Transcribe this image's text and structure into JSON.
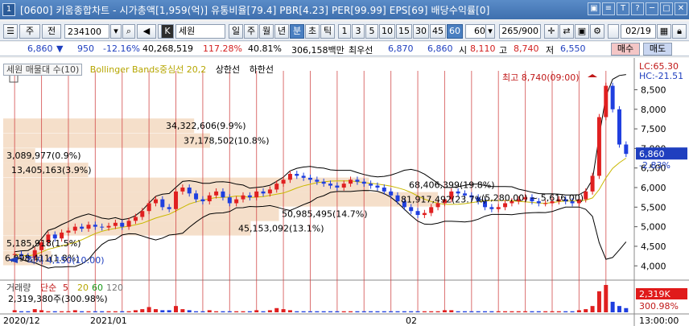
{
  "title": {
    "window_number": "1",
    "text": "[0600] 키움종합차트 - 시가총액[1,959(억)] 유통비율[79.4] PBR[4.23] PER[99.99] EPS[69] 배당수익률[0]",
    "buttons": [
      "▣",
      "≡",
      "T",
      "?",
      "─",
      "□",
      "✕"
    ]
  },
  "toolbar": {
    "stock_type": "주",
    "prev_label": "전",
    "code": "234100",
    "name": "세원",
    "periods": [
      "일",
      "주",
      "월",
      "년",
      "분",
      "초",
      "틱"
    ],
    "active_period": "분",
    "minutes": [
      "1",
      "3",
      "5",
      "10",
      "15",
      "30",
      "45",
      "60"
    ],
    "active_minute": "60",
    "interval_value": "60",
    "count": "265",
    "count_total": "/900",
    "date": "02/19"
  },
  "info": {
    "price": "6,860",
    "change": "950",
    "change_pct": "-12.16%",
    "volume": "40,268,519",
    "volume_ratio": "117.28%",
    "turnover": "40.81%",
    "amount": "306,158백만",
    "best_ask_label": "최우선",
    "best_ask": "6,870",
    "best_bid": "6,860",
    "open_label": "시",
    "open": "8,110",
    "high_label": "고",
    "high": "8,740",
    "low_label": "저",
    "low": "6,550",
    "buy_label": "매수",
    "sell_label": "매도"
  },
  "chart_data": {
    "type": "candlestick",
    "legend": {
      "indicator": "세원 매물대 수(10)",
      "overlay": "Bollinger Bands중심선 20,2",
      "upper": "상한선",
      "lower": "하한선"
    },
    "y_ticks": [
      "8,500",
      "8,000",
      "7,500",
      "7,000",
      "6,500",
      "6,000",
      "5,500",
      "5,000",
      "4,500",
      "4,000"
    ],
    "ylim": [
      3800,
      8900
    ],
    "lc_label": "LC:65.30",
    "hc_label": "HC:-21.51",
    "current_price": "6,860",
    "current_change": "-2.83%",
    "x_labels": [
      "2020/12",
      "2021/01",
      "02"
    ],
    "time_label": "13:00:00",
    "high_annotation": "최고 8,740(09:00)",
    "low_annotation": "최저 4,150(10:00)",
    "volume_profile": [
      {
        "label": "34,322,606(9.9%)",
        "price": 7580
      },
      {
        "label": "37,178,502(10.8%)",
        "price": 7200
      },
      {
        "label": "3,089,977(0.9%)",
        "price": 6820
      },
      {
        "label": "13,405,163(3.9%)",
        "price": 6450
      },
      {
        "label": "68,406,399(19.8%)",
        "price": 6070
      },
      {
        "label": "81,917,492(23.7%)",
        "price": 5700
      },
      {
        "label": "50,985,495(14.7%)",
        "price": 5330
      },
      {
        "label": "45,153,092(13.1%)",
        "price": 4960
      },
      {
        "label": "5,185,918(1.5%)",
        "price": 4580
      },
      {
        "label": "6,098,411(1.8%)",
        "price": 4200
      }
    ],
    "range_annotation": "(5,280,00) ~ 5,616,00)",
    "volume_pane": {
      "title": "거래량",
      "ma_label": "단순",
      "ma_values": [
        "5",
        "20",
        "60",
        "120"
      ],
      "value_text": "2,319,380주(300.98%)",
      "badge": "2,319K",
      "badge_pct": "300.98%"
    },
    "series": {
      "close": [
        4300,
        4250,
        4200,
        4400,
        4600,
        4800,
        4700,
        4850,
        4900,
        5000,
        4950,
        5050,
        5000,
        4980,
        5020,
        5100,
        5000,
        5150,
        5250,
        5400,
        5600,
        5700,
        5500,
        5450,
        5900,
        6000,
        5850,
        5700,
        5650,
        5800,
        5900,
        5750,
        5600,
        5700,
        5800,
        5750,
        5900,
        5850,
        5950,
        6100,
        6200,
        6350,
        6300,
        6250,
        6200,
        6150,
        6100,
        6050,
        6000,
        6100,
        6200,
        6150,
        6100,
        6050,
        6000,
        5900,
        5800,
        5650,
        5500,
        5400,
        5300,
        5350,
        5500,
        5600,
        5700,
        5900,
        5850,
        5800,
        5750,
        5650,
        5500,
        5450,
        5500,
        5600,
        5650,
        5700,
        5750,
        5650,
        5600,
        5600,
        5650,
        5700,
        5650,
        5600,
        5700,
        5900,
        6300,
        7800,
        8600,
        8000,
        7100,
        6860
      ],
      "volume": [
        2,
        1,
        1,
        3,
        2,
        1,
        1,
        1,
        1,
        2,
        1,
        1,
        1,
        1,
        1,
        1,
        1,
        1,
        2,
        3,
        5,
        3,
        2,
        2,
        6,
        3,
        2,
        1,
        1,
        2,
        1,
        1,
        1,
        1,
        1,
        1,
        2,
        1,
        2,
        4,
        3,
        2,
        1,
        1,
        1,
        1,
        1,
        1,
        1,
        1,
        1,
        1,
        1,
        1,
        1,
        1,
        1,
        1,
        1,
        1,
        1,
        1,
        1,
        1,
        2,
        2,
        1,
        1,
        1,
        1,
        1,
        1,
        1,
        1,
        1,
        1,
        1,
        1,
        1,
        1,
        1,
        1,
        1,
        1,
        2,
        3,
        6,
        20,
        26,
        10,
        6,
        4
      ]
    }
  },
  "colors": {
    "up": "#e02020",
    "down": "#1f3fdf",
    "bb_mid": "#c9b800",
    "bb_band": "#000000",
    "profile": "#f4dcc4",
    "grid_red": "#d04040"
  }
}
